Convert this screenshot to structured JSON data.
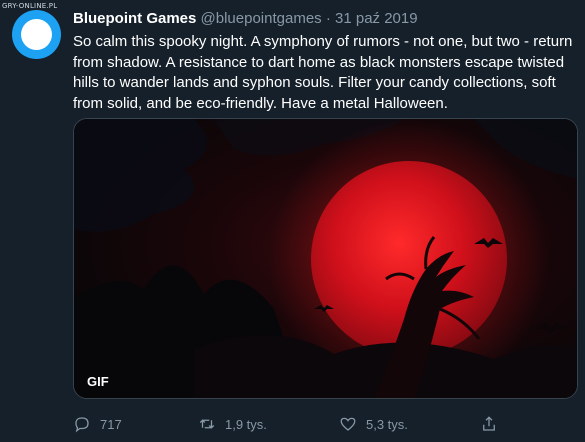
{
  "watermark": "GRY-ONLINE.PL",
  "tweet": {
    "author_name": "Bluepoint Games",
    "handle": "@bluepointgames",
    "separator": "·",
    "date": "31 paź 2019",
    "text": "So calm this spooky night. A symphony of rumors - not one, but two - return from shadow. A resistance to dart home as black monsters escape twisted hills to wander lands and syphon souls. Filter your candy collections, soft from solid, and be eco-friendly. Have a metal Halloween.",
    "media_badge": "GIF"
  },
  "actions": {
    "reply": {
      "icon": "reply-icon",
      "count": "717"
    },
    "retweet": {
      "icon": "retweet-icon",
      "count": "1,9 tys."
    },
    "like": {
      "icon": "heart-icon",
      "count": "5,3 tys."
    },
    "share": {
      "icon": "share-icon"
    }
  },
  "colors": {
    "background": "#15202b",
    "text_primary": "#ffffff",
    "text_secondary": "#8899a6",
    "avatar_brand": "#1da1f2",
    "moon_red": "#c4101a"
  }
}
